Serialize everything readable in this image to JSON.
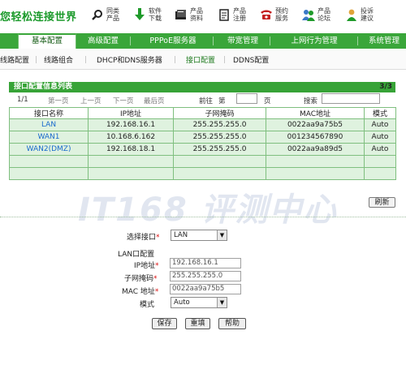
{
  "brand": {
    "logo_text": "您轻松连接世界"
  },
  "top_links": [
    {
      "label": "同类产品",
      "icon": "magnifier-icon"
    },
    {
      "label": "软件下载",
      "icon": "download-arrow-icon"
    },
    {
      "label": "产品资料",
      "icon": "document-stack-icon"
    },
    {
      "label": "产品注册",
      "icon": "register-document-icon"
    },
    {
      "label": "预约服务",
      "icon": "telephone-icon"
    },
    {
      "label": "产品论坛",
      "icon": "forum-people-icon"
    },
    {
      "label": "投诉建议",
      "icon": "complaint-person-icon"
    }
  ],
  "tabs": [
    {
      "label": "基本配置",
      "active": true
    },
    {
      "label": "高级配置"
    },
    {
      "label": "PPPoE服务器"
    },
    {
      "label": "带宽管理"
    },
    {
      "label": "上网行为管理"
    },
    {
      "label": "系统管理"
    }
  ],
  "subnav": [
    {
      "label": "线路配置"
    },
    {
      "label": "线路组合"
    },
    {
      "label": "DHCP和DNS服务器"
    },
    {
      "label": "接口配置",
      "active": true
    },
    {
      "label": "DDNS配置"
    }
  ],
  "list": {
    "title": "接口配置信息列表",
    "count": "3/3",
    "page": "1/1",
    "first": "第一页",
    "prev": "上一页",
    "next": "下一页",
    "last": "最后页",
    "goto_prefix": "前往",
    "goto_di": "第",
    "goto_suffix": "页",
    "goto_value": "",
    "search_label": "搜索",
    "search_value": "",
    "columns": [
      "接口名称",
      "IP地址",
      "子网掩码",
      "MAC地址",
      "模式"
    ],
    "rows": [
      [
        "LAN",
        "192.168.16.1",
        "255.255.255.0",
        "0022aa9a75b5",
        "Auto"
      ],
      [
        "WAN1",
        "10.168.6.162",
        "255.255.255.0",
        "001234567890",
        "Auto"
      ],
      [
        "WAN2(DMZ)",
        "192.168.18.1",
        "255.255.255.0",
        "0022aa9a89d5",
        "Auto"
      ],
      [
        "",
        "",
        "",
        "",
        ""
      ],
      [
        "",
        "",
        "",
        "",
        ""
      ]
    ]
  },
  "refresh_label": "刷新",
  "watermark": "IT168 评测中心",
  "form": {
    "select_iface_label": "选择接口",
    "select_iface_value": "LAN",
    "section_title": "LAN口配置",
    "ip_label": "IP地址",
    "ip_value": "192.168.16.1",
    "mask_label": "子网掩码",
    "mask_value": "255.255.255.0",
    "mac_label": "MAC 地址",
    "mac_value": "0022aa9a75b5",
    "mode_label": "模式",
    "mode_value": "Auto",
    "required_mark": "*"
  },
  "buttons": {
    "save": "保存",
    "reset": "重填",
    "help": "帮助"
  },
  "colors": {
    "accent_green": "#3aa63a",
    "link_blue": "#1a6acd",
    "required_red": "#d11111"
  }
}
